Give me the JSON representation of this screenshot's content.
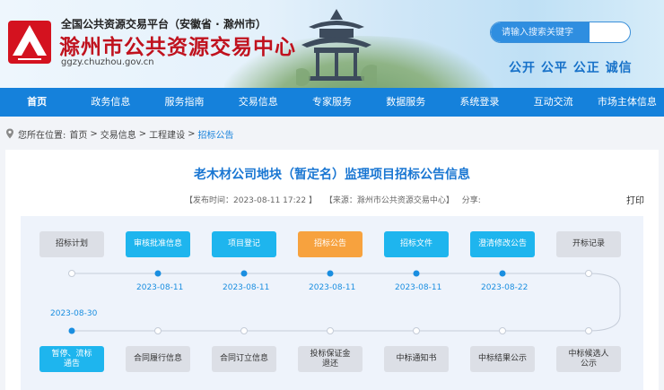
{
  "header": {
    "sup_title": "全国公共资源交易平台（安徽省 · 滁州市）",
    "main_title": "滁州市公共资源交易中心",
    "domain": "ggzy.chuzhou.gov.cn",
    "search_placeholder": "请输入搜索关键字",
    "slogan": "公开 公平 公正 诚信"
  },
  "nav": [
    "首页",
    "政务信息",
    "服务指南",
    "交易信息",
    "专家服务",
    "数据服务",
    "系统登录",
    "互动交流",
    "市场主体信息"
  ],
  "breadcrumb": {
    "prefix": "您所在位置:",
    "items": [
      "首页",
      "交易信息",
      "工程建设",
      "招标公告"
    ]
  },
  "article": {
    "title": "老木材公司地块（暂定名）监理项目招标公告信息",
    "publish_time": "【发布时间：2023-08-11 17:22 】",
    "source": "【来源：滁州市公共资源交易中心】",
    "share": "分享:",
    "print": "打印"
  },
  "flow": {
    "top_row": [
      {
        "label": "招标计划",
        "status": "pending",
        "date": ""
      },
      {
        "label": "审核批准信息",
        "status": "done",
        "date": "2023-08-11"
      },
      {
        "label": "项目登记",
        "status": "done",
        "date": "2023-08-11"
      },
      {
        "label": "招标公告",
        "status": "current",
        "date": "2023-08-11"
      },
      {
        "label": "招标文件",
        "status": "done",
        "date": "2023-08-11"
      },
      {
        "label": "澄清修改公告",
        "status": "done",
        "date": "2023-08-22"
      },
      {
        "label": "开标记录",
        "status": "pending",
        "date": ""
      }
    ],
    "bottom_row": [
      {
        "label": "暂停、流标\n通告",
        "status": "done",
        "date": "2023-08-30"
      },
      {
        "label": "合同履行信息",
        "status": "pending",
        "date": ""
      },
      {
        "label": "合同订立信息",
        "status": "pending",
        "date": ""
      },
      {
        "label": "投标保证金\n退还",
        "status": "pending",
        "date": ""
      },
      {
        "label": "中标通知书",
        "status": "pending",
        "date": ""
      },
      {
        "label": "中标结果公示",
        "status": "pending",
        "date": ""
      },
      {
        "label": "中标候选人\n公示",
        "status": "pending",
        "date": ""
      }
    ]
  },
  "colors": {
    "nav": "#1581db",
    "done": "#1eb5ee",
    "current": "#f7a23e",
    "pending": "#dcdfe6",
    "title": "#1976d2",
    "brand_red": "#c0121e"
  }
}
